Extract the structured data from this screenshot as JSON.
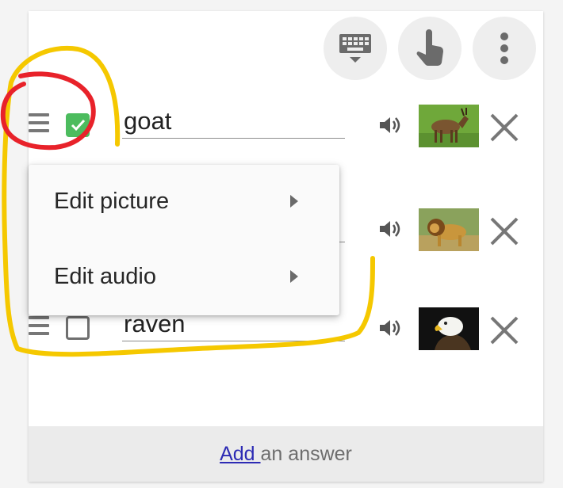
{
  "toolbar": {
    "buttons": [
      {
        "icon": "keyboard-icon"
      },
      {
        "icon": "touch-icon"
      },
      {
        "icon": "more-vert-icon"
      }
    ]
  },
  "answers": [
    {
      "text": "goat",
      "checked": true,
      "picture": "goat"
    },
    {
      "text": "",
      "checked": false,
      "picture": "lion"
    },
    {
      "text": "raven",
      "checked": false,
      "picture": "eagle"
    }
  ],
  "context_menu": {
    "items": [
      {
        "label": "Edit picture",
        "icon": "submenu-arrow-icon"
      },
      {
        "label": "Edit audio",
        "icon": "submenu-arrow-icon"
      }
    ]
  },
  "footer": {
    "add_link": "Add ",
    "rest": "an answer"
  },
  "colors": {
    "check_green": "#4cbc5e",
    "link_blue": "#2d2bb4",
    "annotation_yellow": "#f5c800",
    "annotation_red": "#e8222a"
  }
}
